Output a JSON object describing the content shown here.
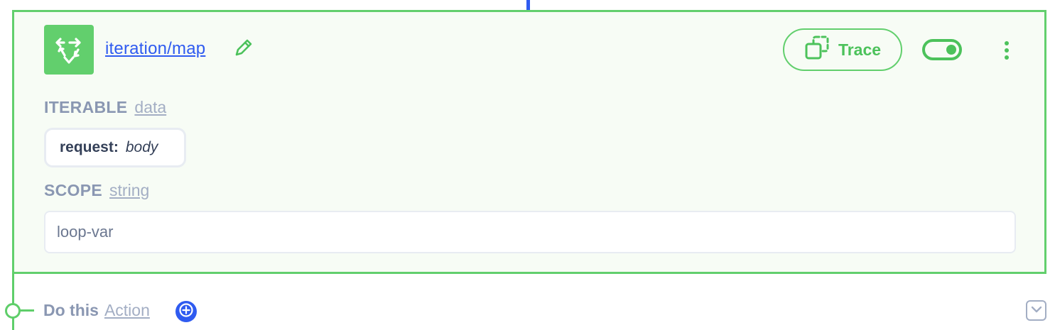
{
  "step": {
    "icon": "loop-arrows-icon",
    "title": "iteration/map",
    "trace_label": "Trace",
    "toggle_on": true
  },
  "fields": {
    "iterable": {
      "label": "ITERABLE",
      "type": "data",
      "chip_key": "request:",
      "chip_value": "body"
    },
    "scope": {
      "label": "SCOPE",
      "type": "string",
      "value": "loop-var"
    }
  },
  "do_this": {
    "label": "Do this",
    "type": "Action"
  },
  "colors": {
    "accent_green": "#62cf6d",
    "link_blue": "#2f5bf0",
    "muted_label": "#8a97b2"
  }
}
